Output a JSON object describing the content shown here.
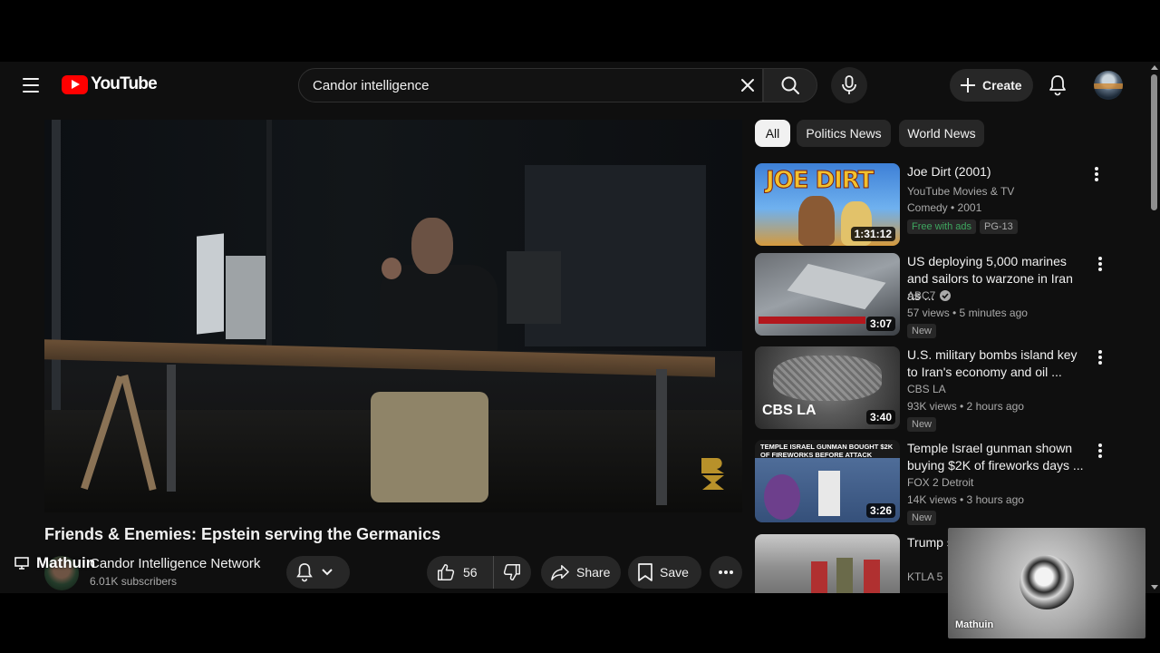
{
  "header": {
    "logo_text": "YouTube",
    "search_value": "Candor intelligence",
    "create_label": "Create"
  },
  "video": {
    "title": "Friends & Enemies: Epstein serving the Germanics",
    "channel": "Candor Intelligence Network",
    "subscribers": "6.01K subscribers",
    "likes": "56",
    "share_label": "Share",
    "save_label": "Save",
    "overlay_name": "Mathuin"
  },
  "chips": [
    {
      "label": "All",
      "active": true
    },
    {
      "label": "Politics News",
      "active": false
    },
    {
      "label": "World News",
      "active": false
    }
  ],
  "recommendations": [
    {
      "title": "Joe Dirt (2001)",
      "channel": "YouTube Movies & TV",
      "meta": "Comedy • 2001",
      "badges": [
        "Free with ads",
        "PG-13"
      ],
      "duration": "1:31:12",
      "thumb_text": "JOE DIRT"
    },
    {
      "title": "US deploying 5,000 marines and sailors to warzone in Iran as ...",
      "channel": "ABC7",
      "verified": true,
      "meta": "57 views • 5 minutes ago",
      "badges": [
        "New"
      ],
      "duration": "3:07"
    },
    {
      "title": "U.S. military bombs island key to Iran's economy and oil ...",
      "channel": "CBS LA",
      "meta": "93K views • 2 hours ago",
      "badges": [
        "New"
      ],
      "duration": "3:40",
      "thumb_text": "CBS LA"
    },
    {
      "title": "Temple Israel gunman shown buying $2K of fireworks days ...",
      "channel": "FOX 2 Detroit",
      "meta": "14K views • 3 hours ago",
      "badges": [
        "New"
      ],
      "duration": "3:26",
      "thumb_text": "TEMPLE ISRAEL GUNMAN BOUGHT $2K OF FIREWORKS BEFORE ATTACK"
    },
    {
      "title": "Trump s military",
      "channel": "KTLA 5"
    }
  ],
  "pip": {
    "name": "Mathuin"
  },
  "colors": {
    "background": "#0f0f0f",
    "brand_red": "#ff0000",
    "chip": "#272727",
    "secondary_text": "#aaaaaa",
    "free_green": "#3ea65f"
  }
}
